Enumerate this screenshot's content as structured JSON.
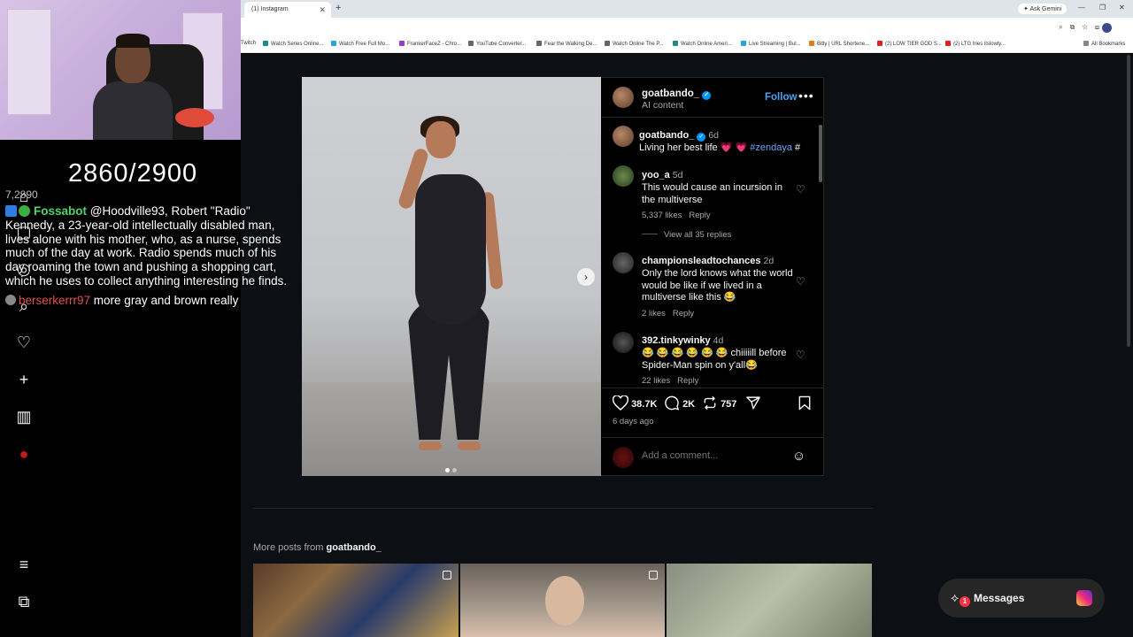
{
  "overlay": {
    "counter": "2860/2900",
    "counter_ghost": "7,2890",
    "chat": [
      {
        "user": "Fossabot",
        "message": "@Hoodville93, Robert \"Radio\" Kennedy, a 23-year-old intellectually disabled man, lives alone with his mother, who, as a nurse, spends much of the day at work. Radio spends much of his day roaming the town and pushing a shopping cart, which he uses to collect anything interesting he finds."
      },
      {
        "user": "berserkerrr97",
        "message": "more gray and brown really"
      }
    ]
  },
  "browser": {
    "tab_title": "(1) Instagram",
    "ask_gemini": "Ask Gemini",
    "bookmarks": [
      "Twitch",
      "Watch Series Online...",
      "Watch Free Full Mo...",
      "FrankerFaceZ - Chro...",
      "YouTube Converter...",
      "Fear the Walking De...",
      "Watch Online The P...",
      "Watch Online Ameri...",
      "Live Streaming | Bul...",
      "Bitly | URL Shortene...",
      "(2) LOW TIER GOD S...",
      "(2) LTG tries itslowly..."
    ],
    "all_bookmarks": "All Bookmarks"
  },
  "post": {
    "author": "goatbando_",
    "author_sub": "AI content",
    "follow_label": "Follow",
    "caption": {
      "user": "goatbando_",
      "ago": "6d",
      "text": "Living her best life 💗 💗 ",
      "hashtag": "#zendaya",
      "trail": " #"
    },
    "comments": [
      {
        "user": "yoo_a",
        "ago": "5d",
        "text": "This would cause an incursion in the multiverse",
        "likes": "5,337 likes",
        "reply": "Reply",
        "view_replies": "View all 35 replies"
      },
      {
        "user": "championsleadtochances",
        "ago": "2d",
        "text": "Only the lord knows what the world would be like if we lived in a multiverse like this 😂",
        "likes": "2 likes",
        "reply": "Reply"
      },
      {
        "user": "392.tinkywinky",
        "ago": "4d",
        "text": "😂 😂 😂 😂 😂 😂 chiiiiill before Spider-Man spin on y'all😂",
        "likes": "22 likes",
        "reply": "Reply"
      }
    ],
    "likes_count": "38.7K",
    "comments_count": "2K",
    "reposts_count": "757",
    "posted_ago": "6 days ago",
    "comment_placeholder": "Add a comment..."
  },
  "more_posts": {
    "prefix": "More posts from ",
    "user": "goatbando_"
  },
  "messages": {
    "label": "Messages",
    "badge": "1"
  },
  "colors": {
    "accent": "#0095f6",
    "follow": "#4ca1f5",
    "background": "#0c0f14",
    "badge": "#ff3040"
  }
}
